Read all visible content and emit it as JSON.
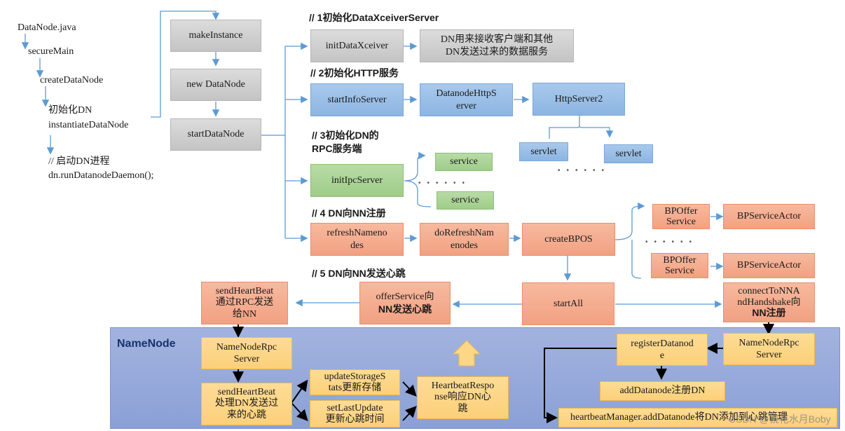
{
  "left_flow": {
    "file": "DataNode.java",
    "secure_main": "secureMain",
    "create_datanode": "createDataNode",
    "init_dn_line1": "初始化DN",
    "init_dn_line2": "instantiateDataNode",
    "start_comment": "// 启动DN进程",
    "run_daemon": "dn.runDatanodeDaemon();"
  },
  "init_chain": {
    "make_instance": "makeInstance",
    "new_datanode": "new DataNode",
    "start_datanode": "startDataNode"
  },
  "section1": {
    "title": "// 1初始化DataXceiverServer",
    "init_xceiver": "initDataXceiver",
    "desc_line1": "DN用来接收客户端和其他",
    "desc_line2": "DN发送过来的数据服务"
  },
  "section2": {
    "title": "// 2初始化HTTP服务",
    "start_info_server": "startInfoServer",
    "datanode_http_server_l1": "DatanodeHttpS",
    "datanode_http_server_l2": "erver",
    "http_server2": "HttpServer2",
    "servlet_a": "servlet",
    "servlet_b": "servlet",
    "dots": "••••••"
  },
  "section3": {
    "title_line1": "// 3初始化DN的",
    "title_line2": "RPC服务端",
    "init_ipc_server": "initIpcServer",
    "service_a": "service",
    "service_b": "service",
    "dots": "••••••"
  },
  "section4": {
    "title": "// 4 DN向NN注册",
    "refresh_namenodes_l1": "refreshNameno",
    "refresh_namenodes_l2": "des",
    "do_refresh_l1": "doRefreshNam",
    "do_refresh_l2": "enodes",
    "create_bpos": "createBPOS",
    "bpoffer_a_l1": "BPOffer",
    "bpoffer_a_l2": "Service",
    "bpoffer_b_l1": "BPOffer",
    "bpoffer_b_l2": "Service",
    "bpservice_actor_a": "BPServiceActor",
    "bpservice_actor_b": "BPServiceActor",
    "dots": "••••••"
  },
  "section5": {
    "title": "// 5 DN向NN发送心跳",
    "start_all": "startAll",
    "offer_service_l1": "offerService向",
    "offer_service_l2": "NN发送心跳",
    "send_heartbeat_l1": "sendHeartBeat",
    "send_heartbeat_l2": "通过RPC发送",
    "send_heartbeat_l3": "给NN",
    "connect_l1": "connectToNNA",
    "connect_l2": "ndHandshake向",
    "connect_l3": "NN注册"
  },
  "namenode": {
    "title": "NameNode",
    "rpc_server_left_l1": "NameNodeRpc",
    "rpc_server_left_l2": "Server",
    "send_hb_l1": "sendHeartBeat",
    "send_hb_l2": "处理DN发送过",
    "send_hb_l3": "来的心跳",
    "update_storage_l1": "updateStorageS",
    "update_storage_l2": "tats更新存储",
    "set_last_update_l1": "setLastUpdate",
    "set_last_update_l2": "更新心跳时间",
    "hb_response_l1": "HeartbeatRespo",
    "hb_response_l2": "nse响应DN心",
    "hb_response_l3": "跳",
    "register_datanode_l1": "registerDatanod",
    "register_datanode_l2": "e",
    "rpc_server_right_l1": "NameNodeRpc",
    "rpc_server_right_l2": "Server",
    "add_datanode": "addDatanode注册DN",
    "heartbeat_manager": "heartbeatManager.addDatanode将DN添加到心跳管理"
  },
  "watermark": "CSDN @镜花水月Boby",
  "colors": {
    "gray": "#c8c8c8",
    "blue": "#9dc3e6",
    "green": "#a9d18e",
    "orange": "#f4b183",
    "yellow": "#ffd966",
    "namenode_panel": "#8faadc",
    "connector": "#5b9bd5"
  }
}
